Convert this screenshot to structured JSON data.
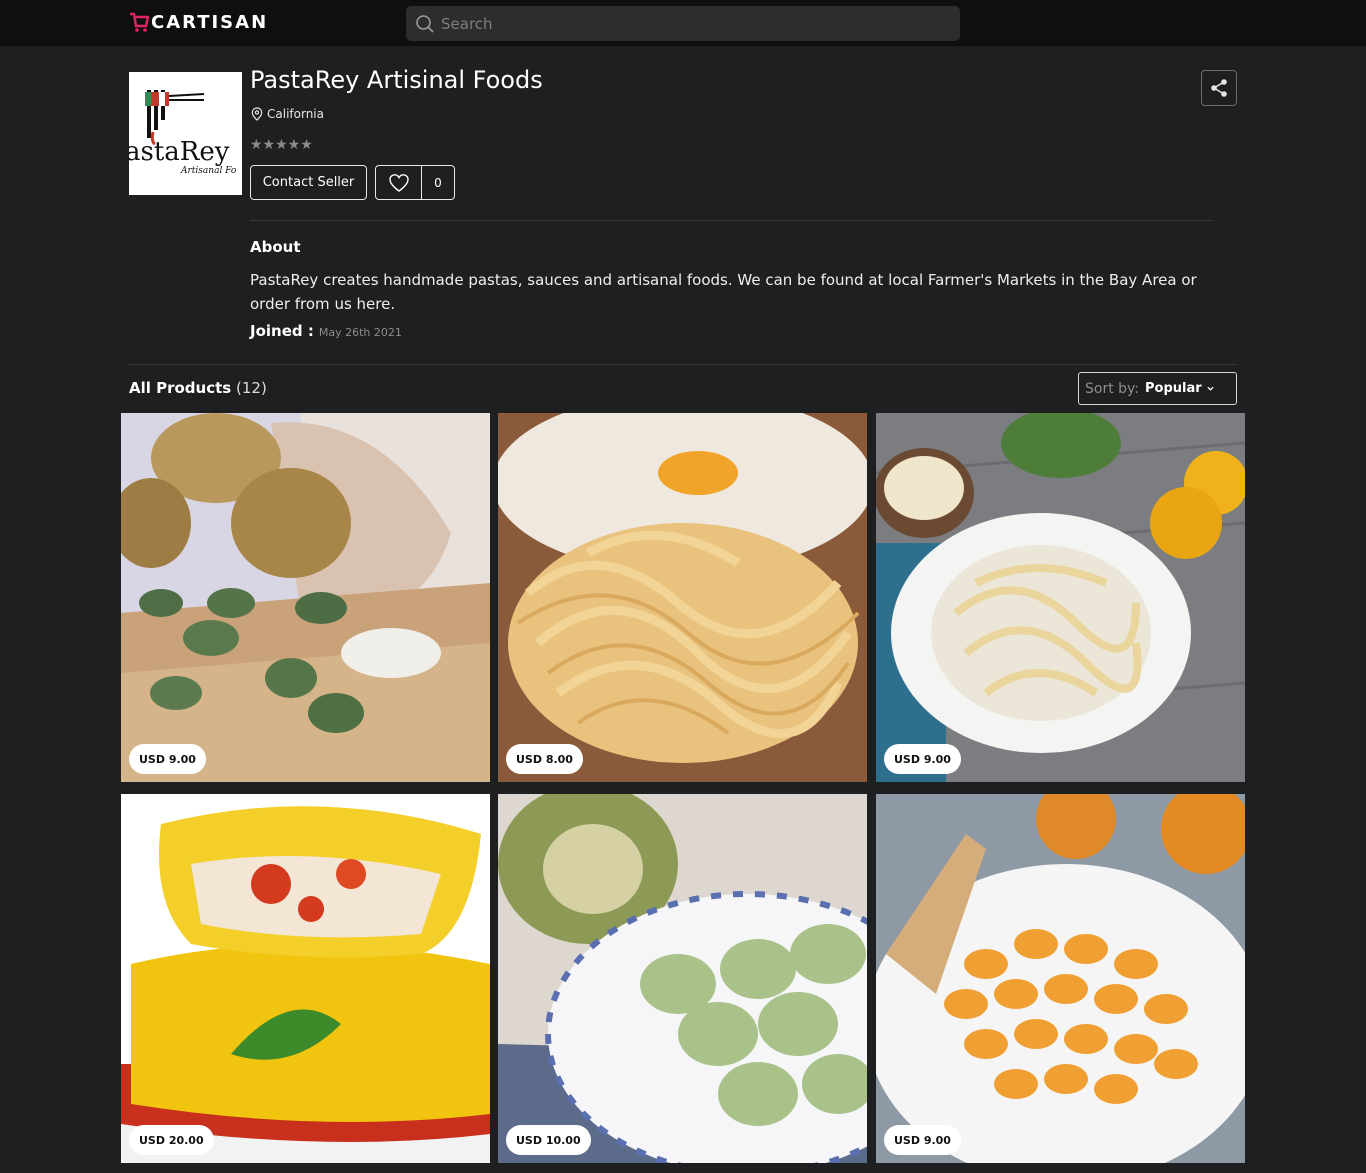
{
  "header": {
    "brand": "CARTISAN",
    "search_placeholder": "Search"
  },
  "store": {
    "name": "PastaRey Artisinal Foods",
    "location": "California",
    "rating_stars": "★★★★★",
    "logo_text": "astaRey",
    "logo_subtext": "Artisanal Fo",
    "contact_label": "Contact Seller",
    "like_count": "0",
    "about_heading": "About",
    "about_text": "PastaRey creates handmade pastas, sauces and artisanal foods. We can be found at local Farmer's Markets in the Bay Area or order from us here.",
    "joined_label": "Joined :",
    "joined_date": "May 26th 2021"
  },
  "products": {
    "heading": "All Products",
    "count": "(12)",
    "sort_label": "Sort by:",
    "sort_value": "Popular",
    "items": [
      {
        "price": "USD 9.00"
      },
      {
        "price": "USD 8.00"
      },
      {
        "price": "USD 9.00"
      },
      {
        "price": "USD 20.00"
      },
      {
        "price": "USD 10.00"
      },
      {
        "price": "USD 9.00"
      }
    ]
  },
  "colors": {
    "background": "#1e1f20",
    "topbar": "#0f0f10",
    "brand_accent": "#e0245e"
  }
}
